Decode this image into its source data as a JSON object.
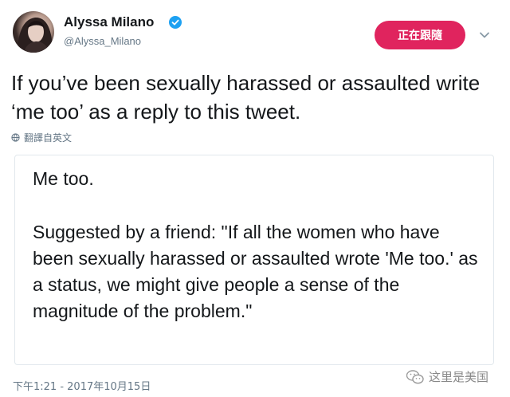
{
  "author": {
    "name": "Alyssa Milano",
    "handle": "@Alyssa_Milano",
    "avatar_icon": "profile-photo",
    "verified_icon": "verified-badge-icon",
    "verified_color": "#1da1f2"
  },
  "follow_button": {
    "label": "正在跟隨",
    "color": "#e0245e"
  },
  "menu_icon": "chevron-down-icon",
  "tweet": {
    "text": "If you’ve been sexually harassed or assaulted write ‘me too’ as a reply to this tweet.",
    "translate_label": "翻譯自英文",
    "translate_icon": "globe-icon"
  },
  "quote": {
    "line1": "Me too.",
    "body": "Suggested by a friend: \"If all the women who have been sexually harassed or assaulted wrote 'Me too.' as a status, we might give people a sense of the magnitude of the problem.\""
  },
  "timestamp": "下午1:21 - 2017年10月15日",
  "watermark": {
    "text": "这里是美国",
    "icon": "wechat-icon"
  }
}
